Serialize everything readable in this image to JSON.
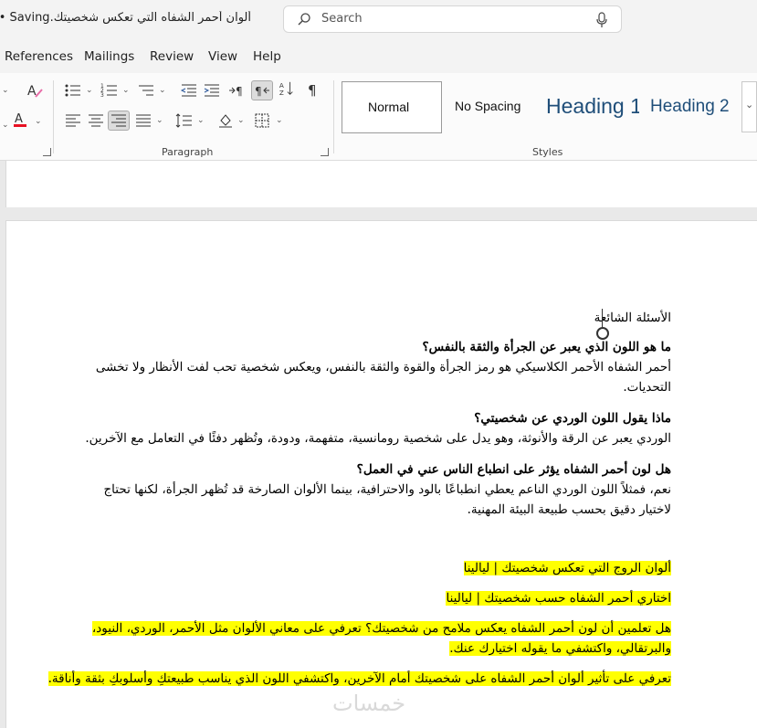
{
  "titlebar": {
    "doc_name": "ألوان أحمر الشفاه التي تعكس شخصيتك.docx",
    "separator": "•",
    "status": "Saving...",
    "search_placeholder": "Search"
  },
  "menu": {
    "items": [
      "References",
      "Mailings",
      "Review",
      "View",
      "Help"
    ]
  },
  "ribbon": {
    "paragraph_label": "Paragraph",
    "styles_label": "Styles",
    "styles": [
      {
        "label": "Normal"
      },
      {
        "label": "No Spacing"
      },
      {
        "label": "Heading 1",
        "display": "Heading 1"
      },
      {
        "label": "Heading 2"
      }
    ],
    "accent_colors": {
      "heading": "#1f4e79",
      "font_color": "#e81123",
      "highlight": "#ffff00"
    }
  },
  "document": {
    "faq_title": "الأسئلة الشائعة",
    "q1": "ما هو اللون الذي يعبر عن الجرأة والثقة بالنفس؟",
    "a1_line1": "أحمر الشفاه الأحمر الكلاسيكي هو رمز الجرأة والقوة والثقة بالنفس، ويعكس شخصية تحب لفت الأنظار ولا تخشى",
    "a1_line2": "التحديات.",
    "q2": "ماذا يقول اللون الوردي عن شخصيتي؟",
    "a2": "الوردي يعبر عن الرقة والأنوثة، وهو يدل على شخصية رومانسية، متفهمة، ودودة، وتُظهر دفئًا في التعامل مع الآخرين.",
    "q3": "هل لون أحمر الشفاه يؤثر على انطباع الناس عني في العمل؟",
    "a3_line1": "نعم، فمثلاً اللون الوردي الناعم يعطي انطباعًا بالود والاحترافية، بينما الألوان الصارخة قد تُظهر الجرأة، لكنها تحتاج",
    "a3_line2": "لاختيار دقيق بحسب طبيعة البيئة المهنية.",
    "h1": "ألوان الروج التي تعكس شخصيتك | ليالينا",
    "h2": "اختاري أحمر الشفاه حسب شخصيتك | ليالينا",
    "h3_line1": "هل تعلمين أن لون أحمر الشفاه يعكس ملامح من شخصيتك؟ تعرفي على معاني الألوان مثل الأحمر، الوردي، النيود،",
    "h3_line2": "والبرتقالي، واكتشفي ما يقوله اختيارك عنك.",
    "h4": "تعرفي على تأثير ألوان أحمر الشفاه على شخصيتك أمام الآخرين، واكتشفي اللون الذي يناسب طبيعتكِ وأسلوبكِ بثقة وأناقة."
  },
  "watermark": "خمسات"
}
